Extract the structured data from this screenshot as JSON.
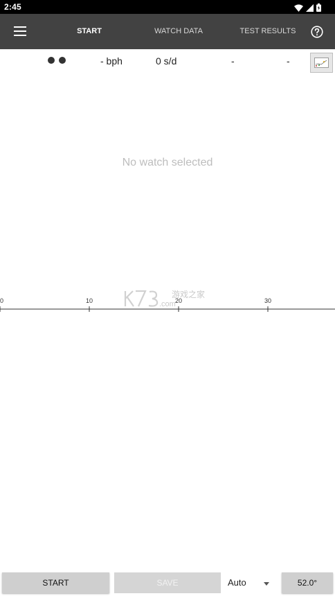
{
  "status_bar": {
    "time": "2:45",
    "icons": [
      "wifi-icon",
      "cell-signal-icon",
      "battery-icon"
    ]
  },
  "app_bar": {
    "tabs": [
      {
        "label": "START",
        "active": true
      },
      {
        "label": "WATCH DATA",
        "active": false
      },
      {
        "label": "TEST RESULTS",
        "active": false
      }
    ]
  },
  "readout": {
    "rate": "- bph",
    "deviation": "0 s/d",
    "amplitude": "-",
    "beat_error": "-"
  },
  "main": {
    "empty_message": "No watch selected"
  },
  "timeline": {
    "ticks": [
      "0",
      "10",
      "20",
      "30"
    ]
  },
  "watermark": {
    "logo_text": "K73",
    "site": "游戏之家",
    "domain": ".com"
  },
  "bottom_bar": {
    "start_label": "START",
    "save_label": "SAVE",
    "mode_value": "Auto",
    "angle_label": "52.0°"
  },
  "colors": {
    "app_bar": "#424242",
    "status_bar": "#000000",
    "button": "#cfcfcf"
  }
}
